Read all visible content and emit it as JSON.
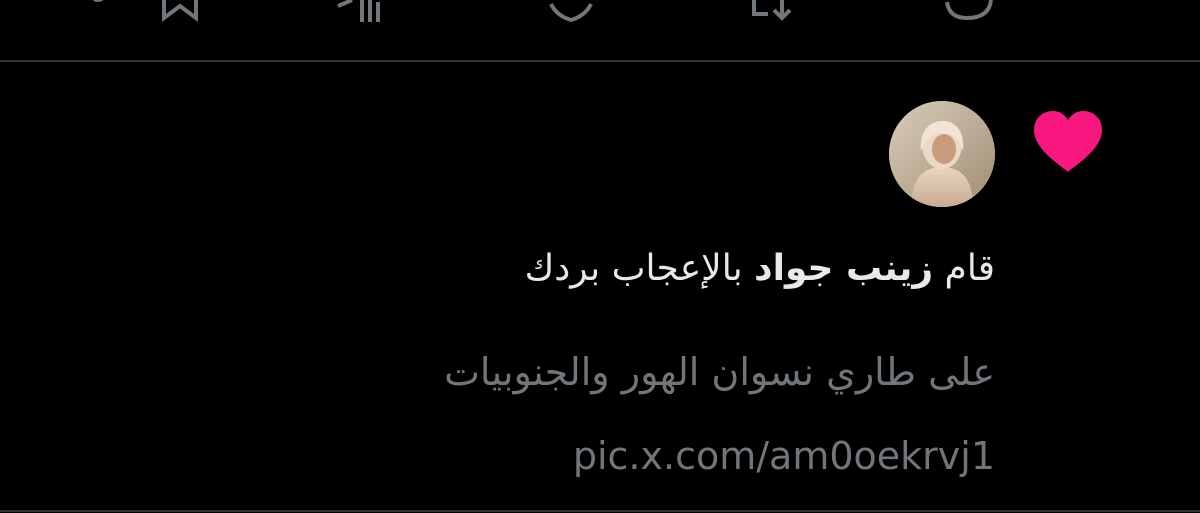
{
  "colors": {
    "background": "#000000",
    "divider": "#2f3336",
    "primary_text": "#e7e9ea",
    "secondary_text": "#71767b",
    "like_accent": "#f91880"
  },
  "action_bar": {
    "icons": [
      "share-icon",
      "bookmark-icon",
      "views-icon",
      "like-icon",
      "retweet-icon",
      "reply-icon"
    ]
  },
  "notification": {
    "icon": "heart-icon",
    "avatar": "avatar",
    "prefix": "قام",
    "user_name": "زينب جواد",
    "suffix": "بالإعجاب بردك",
    "tweet_text": "على طاري نسوان الهور والجنوبيات pic.x.com/am0oekrvj1"
  }
}
